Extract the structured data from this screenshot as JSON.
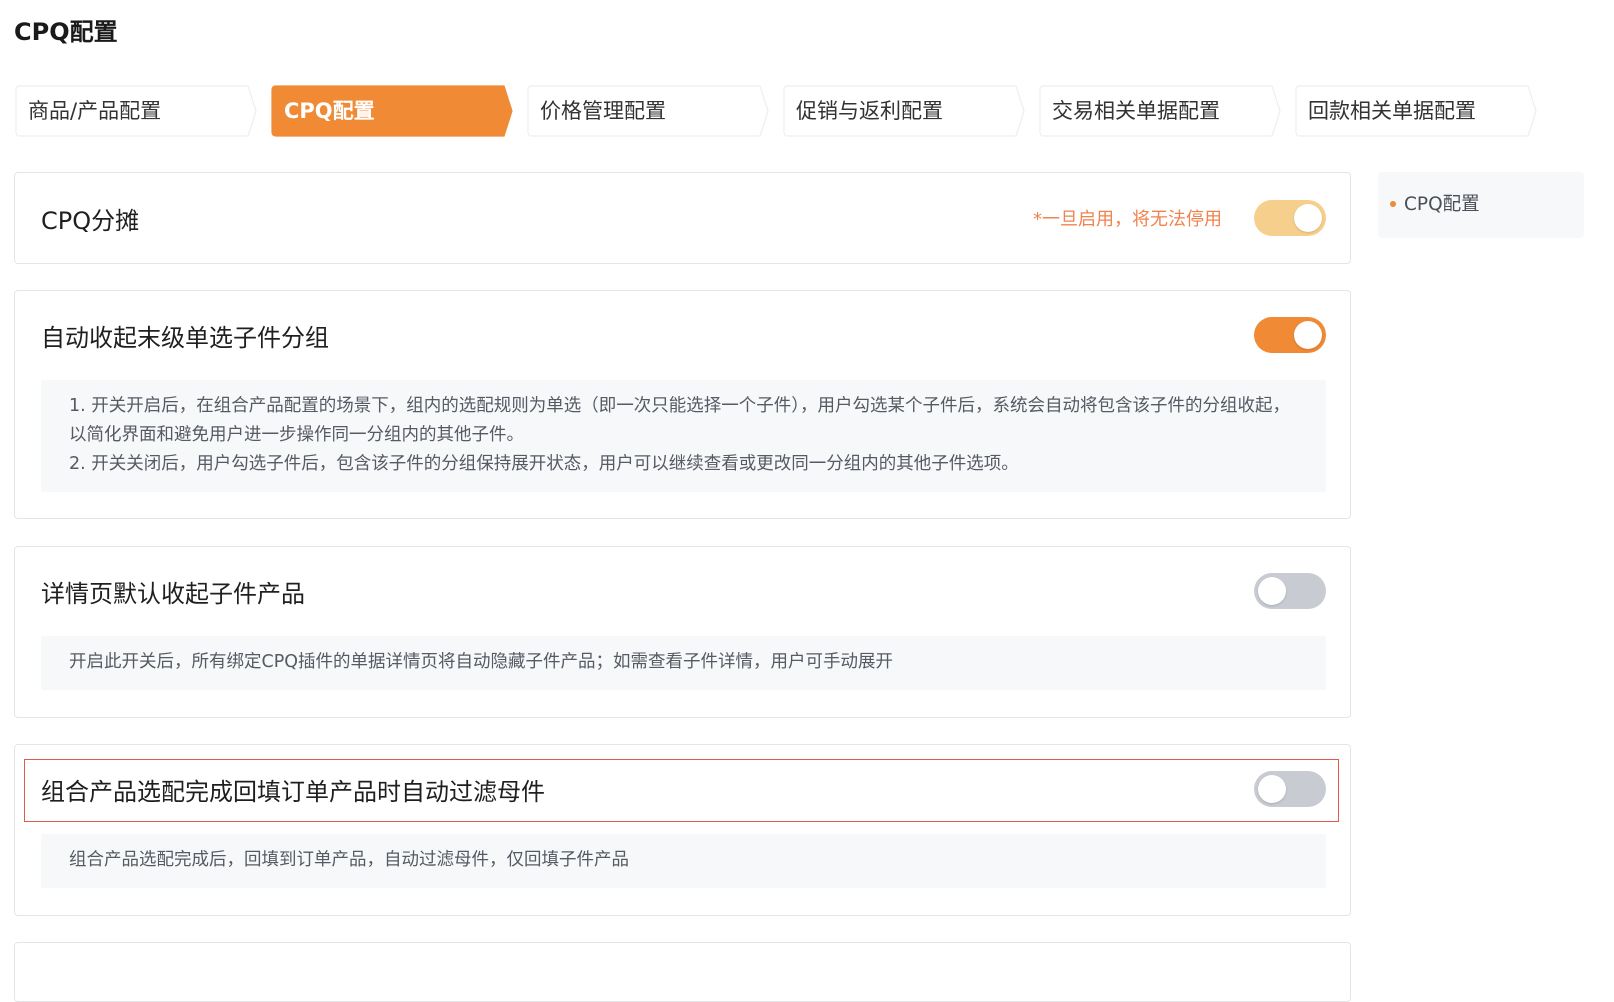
{
  "page": {
    "title": "CPQ配置"
  },
  "steps": [
    {
      "label": "商品/产品配置",
      "active": false
    },
    {
      "label": "CPQ配置",
      "active": true
    },
    {
      "label": "价格管理配置",
      "active": false
    },
    {
      "label": "促销与返利配置",
      "active": false
    },
    {
      "label": "交易相关单据配置",
      "active": false
    },
    {
      "label": "回款相关单据配置",
      "active": false
    }
  ],
  "settings": [
    {
      "title": "CPQ分摊",
      "warning": "*一旦启用，将无法停用",
      "toggle_state": "on-disabled"
    },
    {
      "title": "自动收起末级单选子件分组",
      "toggle_state": "on",
      "description": [
        "1. 开关开启后，在组合产品配置的场景下，组内的选配规则为单选（即一次只能选择一个子件），用户勾选某个子件后，系统会自动将包含该子件的分组收起，以简化界面和避免用户进一步操作同一分组内的其他子件。",
        "2. 开关关闭后，用户勾选子件后，包含该子件的分组保持展开状态，用户可以继续查看或更改同一分组内的其他子件选项。"
      ]
    },
    {
      "title": "详情页默认收起子件产品",
      "toggle_state": "off",
      "description": [
        "开启此开关后，所有绑定CPQ插件的单据详情页将自动隐藏子件产品；如需查看子件详情，用户可手动展开"
      ]
    },
    {
      "title": "组合产品选配完成回填订单产品时自动过滤母件",
      "toggle_state": "off",
      "description": [
        "组合产品选配完成后，回填到订单产品，自动过滤母件，仅回填子件产品"
      ]
    }
  ],
  "anchor_nav": {
    "items": [
      "CPQ配置"
    ]
  },
  "colors": {
    "accent": "#f08a34",
    "accent_light": "#f7cf8c",
    "toggle_off": "#c8cbd1",
    "warning": "#f0824d",
    "highlight_border": "#e55a4c"
  }
}
